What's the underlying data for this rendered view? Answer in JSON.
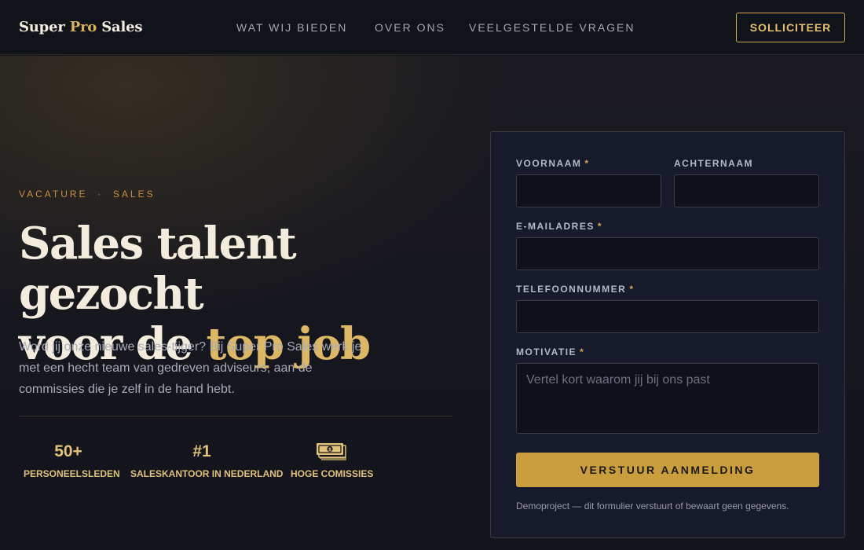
{
  "header": {
    "logo": {
      "part1": "Super ",
      "part2": "Pro",
      "part3": " Sales"
    },
    "nav": [
      "WAT WIJ BIEDEN",
      "OVER ONS",
      "VEELGESTELDE VRAGEN"
    ],
    "cta_label": "SOLLICITEER"
  },
  "hero": {
    "eyebrow": "VACATURE  ·  SALES",
    "headline": {
      "line1": "Sales talent gezocht",
      "line2_prefix": "voor de ",
      "line2_highlight": "top job"
    },
    "intro": "Word jij onze nieuwe sales-tijger? Bij Super Pro Sales werk je met een hecht team van gedreven adviseurs, aan de commissies die je zelf in de hand hebt.",
    "stats": [
      {
        "value": "50+",
        "label": "PERSONEELSLEDEN"
      },
      {
        "value": "#1",
        "label": "SALESKANTOOR IN NEDERLAND"
      },
      {
        "value": "",
        "label": "HOGE COMISSIES",
        "icon": "money-icon"
      }
    ]
  },
  "form": {
    "first_name": {
      "label": "VOORNAAM",
      "required_mark": "*",
      "value": ""
    },
    "last_name": {
      "label": "ACHTERNAAM",
      "value": ""
    },
    "email": {
      "label": "E-MAILADRES",
      "required_mark": "*",
      "value": ""
    },
    "phone": {
      "label": "TELEFOONNUMMER",
      "required_mark": "*",
      "value": ""
    },
    "motivation": {
      "label": "MOTIVATIE",
      "required_mark": "*",
      "placeholder": "Vertel kort waarom jij bij ons past",
      "value": ""
    },
    "submit_label": "VERSTUUR AANMELDING",
    "disclaimer": "Demoproject — dit formulier verstuurt of bewaart geen gegevens."
  },
  "colors": {
    "accent_gold": "#dcb765",
    "button_gold": "#cb9e3d",
    "background": "#12131b",
    "form_background": "#161a2c"
  }
}
